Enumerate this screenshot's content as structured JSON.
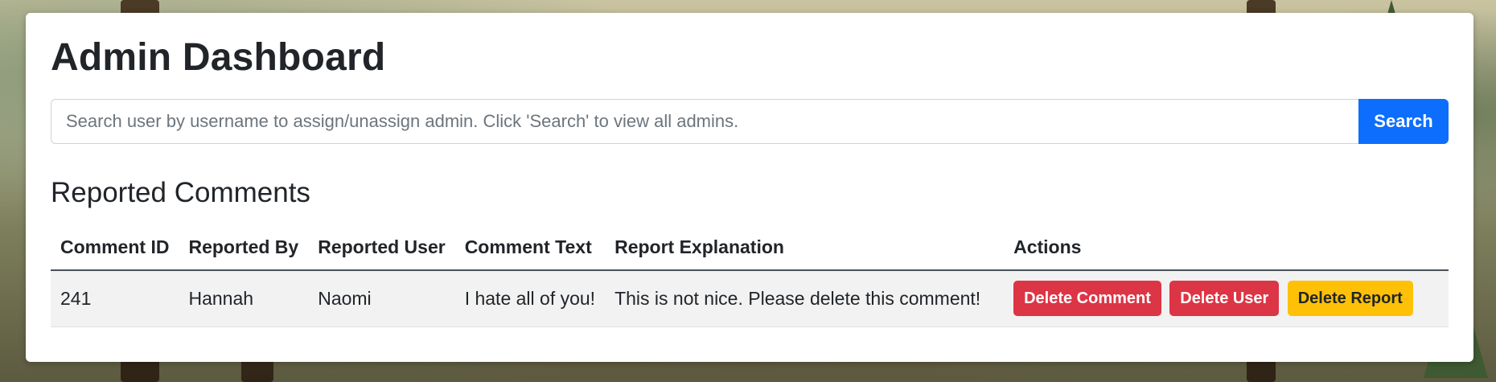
{
  "page": {
    "title": "Admin Dashboard",
    "search": {
      "placeholder": "Search user by username to assign/unassign admin. Click 'Search' to view all admins.",
      "value": "",
      "button_label": "Search"
    },
    "reported_section_title": "Reported Comments"
  },
  "table": {
    "headers": {
      "comment_id": "Comment ID",
      "reported_by": "Reported By",
      "reported_user": "Reported User",
      "comment_text": "Comment Text",
      "report_explanation": "Report Explanation",
      "actions": "Actions"
    },
    "rows": [
      {
        "comment_id": "241",
        "reported_by": "Hannah",
        "reported_user": "Naomi",
        "comment_text": "I hate all of you!",
        "report_explanation": "This is not nice. Please delete this comment!",
        "actions": {
          "delete_comment": "Delete Comment",
          "delete_user": "Delete User",
          "delete_report": "Delete Report"
        }
      }
    ]
  },
  "colors": {
    "primary": "#0d6efd",
    "danger": "#dc3545",
    "warning": "#ffc107",
    "row_background": "#f2f2f2"
  }
}
